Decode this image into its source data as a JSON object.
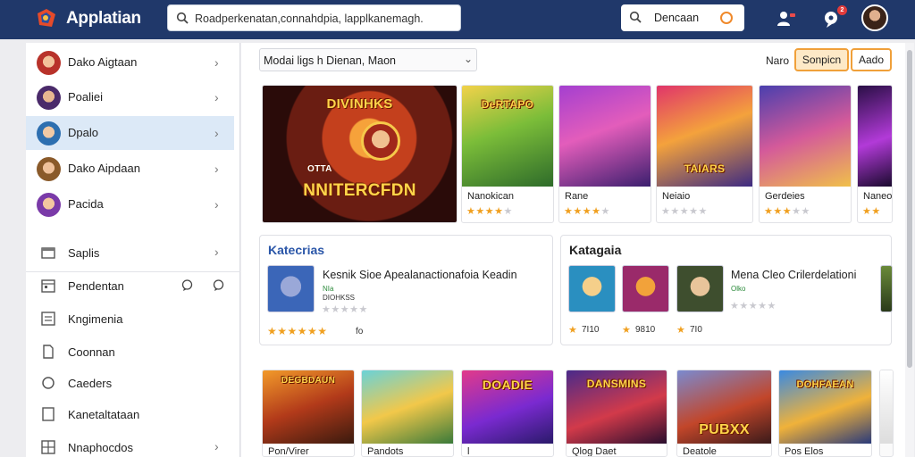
{
  "app": {
    "title": "Applatian"
  },
  "search": {
    "value": "Roadperkenatan,connahdpia, lapplkanemagh."
  },
  "search2": {
    "label": "Dencaan"
  },
  "notifications": {
    "badge": "2"
  },
  "sidebar": {
    "items": [
      {
        "label": "Dako Aigtaan"
      },
      {
        "label": "Poaliei"
      },
      {
        "label": "Dpalo"
      },
      {
        "label": "Dako Aipdaan"
      },
      {
        "label": "Pacida"
      }
    ],
    "nav": [
      {
        "label": "Saplis",
        "icon": "folder-icon"
      },
      {
        "label": "Pendentan",
        "icon": "calendar-icon"
      },
      {
        "label": "Kngimenia",
        "icon": "list-icon"
      },
      {
        "label": "Coonnan",
        "icon": "document-icon"
      },
      {
        "label": "Caeders",
        "icon": "circle-icon"
      },
      {
        "label": "Kanetaltataan",
        "icon": "file-icon"
      },
      {
        "label": "Nnaphocdos",
        "icon": "grid-icon"
      }
    ]
  },
  "toolbar": {
    "filter": "Modai ligs h Dienan, Maon",
    "sort_label": "Naro",
    "primary_button": "Sonpicn",
    "secondary_button": "Aado"
  },
  "featured": {
    "art_top": "DIVINHKS",
    "art_bottom": "NNITERCFDN",
    "art_tag": "OTTA"
  },
  "top_cards": [
    {
      "name": "Nanokican",
      "rating": 4,
      "art": "DeRTAPO"
    },
    {
      "name": "Rane",
      "rating": 4,
      "art": ""
    },
    {
      "name": "Neiaio",
      "rating": 0,
      "art": "TAIARS"
    },
    {
      "name": "Gerdeies",
      "rating": 3,
      "art": ""
    },
    {
      "name": "Naneo",
      "rating": 4,
      "art": ""
    }
  ],
  "panel_left": {
    "title": "Katecrias",
    "text": "Kesnik Sioe Apealanactionafoia Keadin",
    "sub1": "NIa",
    "sub2": "DIOHKSS",
    "rating_small": 0,
    "rating_large": 5,
    "rating_value": "fo"
  },
  "panel_right": {
    "title": "Katagaia",
    "text": "Mena Cleo Crilerdelationi",
    "sub": "Olko",
    "rating_small": 0,
    "prices": [
      "7I10",
      "9810",
      "7I0"
    ]
  },
  "bottom_cards": [
    {
      "name": "Pon/Virer",
      "art": "DEGBDAUN"
    },
    {
      "name": "Pandots",
      "art": ""
    },
    {
      "name": "l",
      "art": "DOADIE"
    },
    {
      "name": "Qlog Daet",
      "art": "DANSMINS"
    },
    {
      "name": "Deatole",
      "art": "PUBXX"
    },
    {
      "name": "Pos Elos",
      "art": "DOHFAEAN"
    }
  ],
  "colors": {
    "topbar": "#20386a",
    "accent": "#f0a03a",
    "star": "#f0a020",
    "active_row": "#dce9f7",
    "notif": "#e23b3b"
  }
}
